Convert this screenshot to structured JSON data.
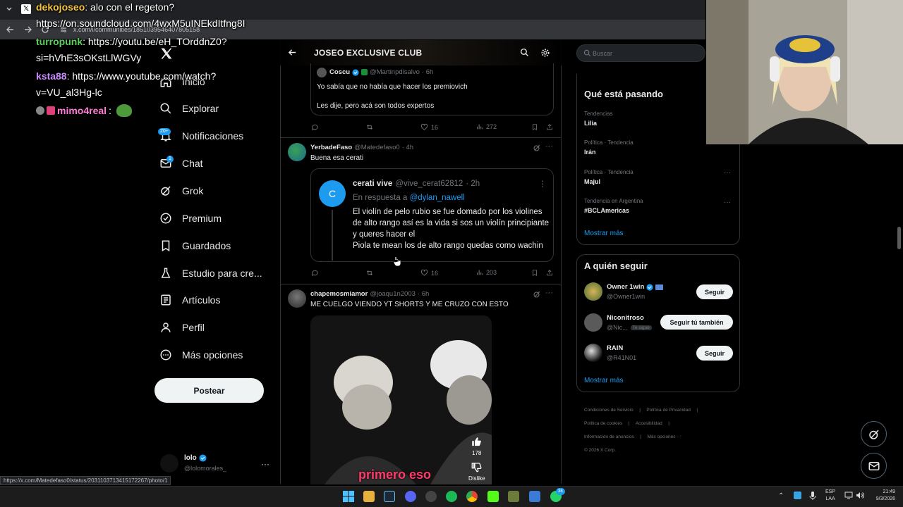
{
  "browser": {
    "url": "x.com/i/communities/1851039546407805158",
    "status_url": "https://x.com/Matedefaso0/status/2031103713415172267/photo/1"
  },
  "chat": [
    {
      "user": "dekojoseo",
      "user_color": "#f5c542",
      "msg": ": alo con el regeton?",
      "cont": "https://on.soundcloud.com/4wxM5uINEkdItfng8I"
    },
    {
      "user": "turropunk",
      "user_color": "#5ad15a",
      "msg": ": https://youtu.be/eH_TOrddnZ0?",
      "cont": "si=hVhE3sOKstLlWGVy"
    },
    {
      "user": "ksta88",
      "user_color": "#c98bff",
      "msg": ": https://www.youtube.com/watch?",
      "cont": "v=VU_al3Hg-lc"
    },
    {
      "user": "mimo4real",
      "user_color": "#ff7bd5",
      "msg": ":",
      "cont": ""
    }
  ],
  "nav": [
    {
      "id": "home",
      "label": "Inicio",
      "icon": "home-icon"
    },
    {
      "id": "explore",
      "label": "Explorar",
      "icon": "search-icon"
    },
    {
      "id": "notifications",
      "label": "Notificaciones",
      "icon": "bell-icon",
      "badge": "20+"
    },
    {
      "id": "chat",
      "label": "Chat",
      "icon": "mail-icon",
      "badge": "1"
    },
    {
      "id": "grok",
      "label": "Grok",
      "icon": "grok-icon"
    },
    {
      "id": "premium",
      "label": "Premium",
      "icon": "verified-icon"
    },
    {
      "id": "bookmarks",
      "label": "Guardados",
      "icon": "bookmark-icon"
    },
    {
      "id": "studio",
      "label": "Estudio para cre...",
      "icon": "flask-icon"
    },
    {
      "id": "articles",
      "label": "Artículos",
      "icon": "article-icon"
    },
    {
      "id": "profile",
      "label": "Perfil",
      "icon": "person-icon"
    },
    {
      "id": "more",
      "label": "Más opciones",
      "icon": "more-circle-icon"
    }
  ],
  "post_button": "Postear",
  "account": {
    "name": "lolo",
    "handle": "@lolomorales_"
  },
  "community": {
    "title": "JOSEO EXCLUSIVE CLUB"
  },
  "posts": {
    "quoted": {
      "name": "Coscu",
      "handle": "@Martinpdisalvo",
      "time": "· 6h",
      "line1": "Yo sabía que no había que hacer los premiovich",
      "line2": "Les dije, pero acá son todos expertos",
      "replies": "",
      "reposts": "",
      "likes": "16",
      "views": "272"
    },
    "p1": {
      "name": "YerbadeFaso",
      "handle": "@Matedefaso0",
      "time": "· 4h",
      "text": "Buena esa cerati",
      "quote": {
        "avatar_letter": "C",
        "name": "cerati vive",
        "handle": "@vive_cerat62812",
        "time": "· 2h",
        "reply_prefix": "En respuesta a ",
        "reply_to": "@dylan_nawell",
        "text": "El violín de pelo rubio se fue domado por los violines de alto rango así es la vida si sos un violín principiante y queres hacer el",
        "text2": "Piola te mean los de alto rango quedas como wachin"
      },
      "likes": "16",
      "views": "203"
    },
    "p2": {
      "name": "chapemosmiamor",
      "handle": "@joaqu1n2003",
      "time": "· 6h",
      "text": "ME CUELGO VIENDO YT SHORTS Y ME CRUZO CON ESTO",
      "media_caption": "primero eso",
      "media_likes": "178",
      "media_dislike": "Dislike"
    }
  },
  "search": {
    "placeholder": "Buscar"
  },
  "trends": {
    "title": "Qué está pasando",
    "items": [
      {
        "context": "Tendencias",
        "name": "Lilia"
      },
      {
        "context": "Política · Tendencia",
        "name": "Irán"
      },
      {
        "context": "Política · Tendencia",
        "name": "Majul"
      },
      {
        "context": "Tendencia en Argentina",
        "name": "#BCLAmericas"
      }
    ],
    "more": "Mostrar más"
  },
  "who_to_follow": {
    "title": "A quién seguir",
    "items": [
      {
        "name": "Owner 1win",
        "handle": "@Owner1win",
        "button": "Seguir"
      },
      {
        "name": "Niconitroso",
        "handle": "@Nic...",
        "tag": "Te sigue",
        "button": "Seguir tú también"
      },
      {
        "name": "RAIN",
        "handle": "@R41N01",
        "button": "Seguir"
      }
    ],
    "more": "Mostrar más"
  },
  "footer": {
    "links": [
      "Condiciones de Servicio",
      "|",
      "Política de Privacidad",
      "|",
      "Política de cookies",
      "|",
      "Accesibilidad",
      "|",
      "Información de anuncios",
      "|",
      "Más opciones ···"
    ],
    "copyright": "© 2026 X Corp."
  },
  "taskbar": {
    "lang1": "ESP",
    "lang2": "LAA",
    "time": "21:49",
    "date": "9/3/2026",
    "whatsapp_badge": "38"
  },
  "colors": {
    "accent": "#1d9bf0",
    "bg": "#000000",
    "border": "#2f3336",
    "muted": "#71767b"
  }
}
